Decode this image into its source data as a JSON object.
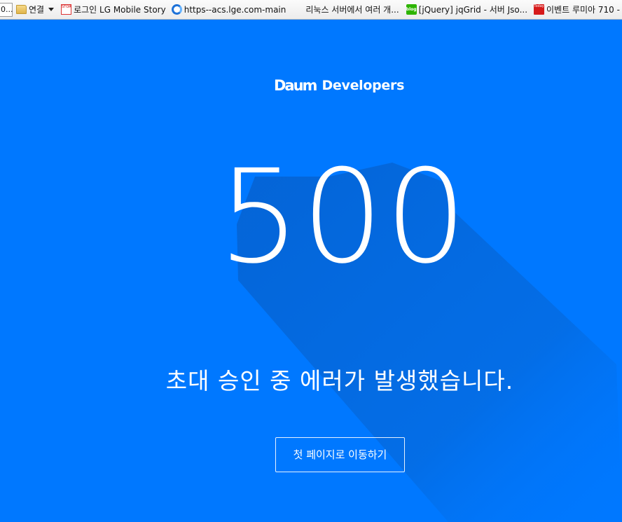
{
  "bookmarks_bar": {
    "items": [
      {
        "label": "0...",
        "icon": "truncated-bookmark"
      },
      {
        "label": "연결",
        "icon": "folder-icon"
      },
      {
        "label": "로그인 LG Mobile Story",
        "icon": "lg-story-icon"
      },
      {
        "label": "https--acs.lge.com-main",
        "icon": "ie-icon"
      },
      {
        "label": "리눅스 서버에서 여러 개...",
        "icon": ""
      },
      {
        "label": "[jQuery] jqGrid - 서버 Jso...",
        "icon": "blog-icon"
      },
      {
        "label": "이벤트  루미아 710 -",
        "icon": "today-icon"
      }
    ]
  },
  "page": {
    "logo_mark": "Daum",
    "logo_text": "Developers",
    "error_code": "500",
    "message": "초대 승인 중 에러가 발생했습니다.",
    "home_button_label": "첫 페이지로 이동하기",
    "colors": {
      "background": "#0078ff",
      "shadow": "#0563d4",
      "text": "#ffffff"
    }
  }
}
